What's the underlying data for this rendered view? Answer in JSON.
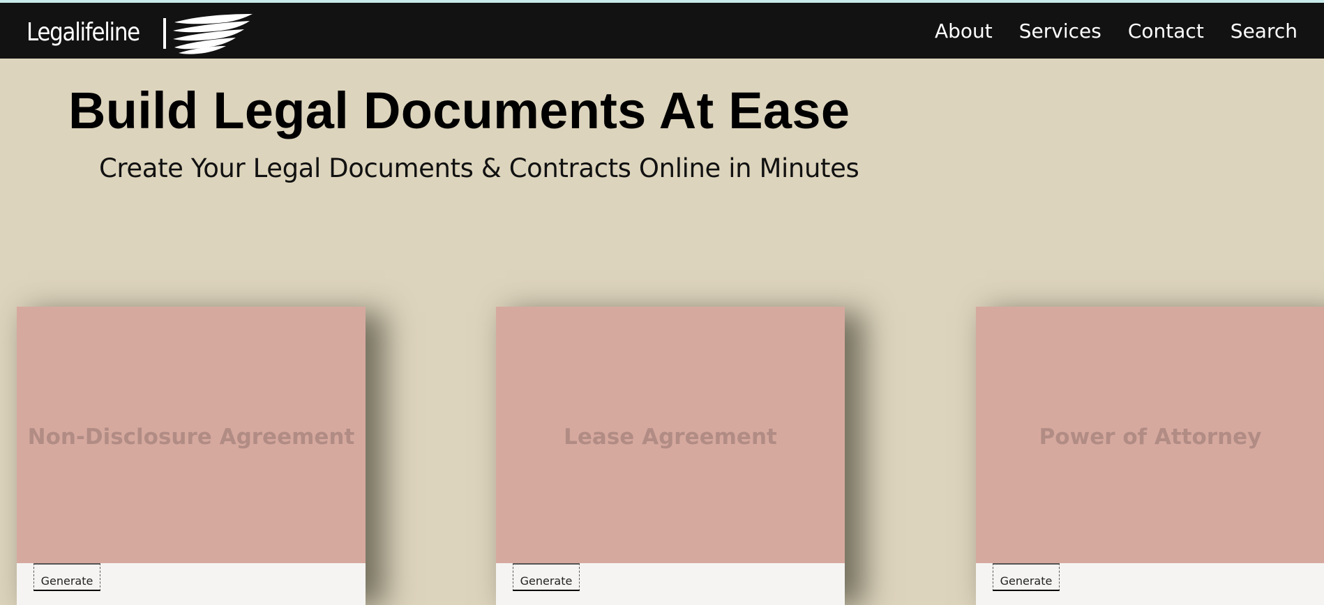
{
  "brand": {
    "name": "Legalifeline",
    "logo_icon": "wing-logo-icon"
  },
  "nav": {
    "items": [
      {
        "label": "About"
      },
      {
        "label": "Services"
      },
      {
        "label": "Contact"
      },
      {
        "label": "Search"
      }
    ]
  },
  "hero": {
    "title": "Build Legal Documents At Ease",
    "subtitle": "Create Your Legal Documents & Contracts Online in Minutes"
  },
  "cards": [
    {
      "title": "Non-Disclosure Agreement",
      "button_label": "Generate"
    },
    {
      "title": "Lease Agreement",
      "button_label": "Generate"
    },
    {
      "title": "Power of Attorney",
      "button_label": "Generate"
    }
  ],
  "colors": {
    "background": "#ddd4bd",
    "navbar": "#121212",
    "card": "#d6a99f",
    "card_title": "#b18c84",
    "card_footer": "#f5f4f2"
  }
}
